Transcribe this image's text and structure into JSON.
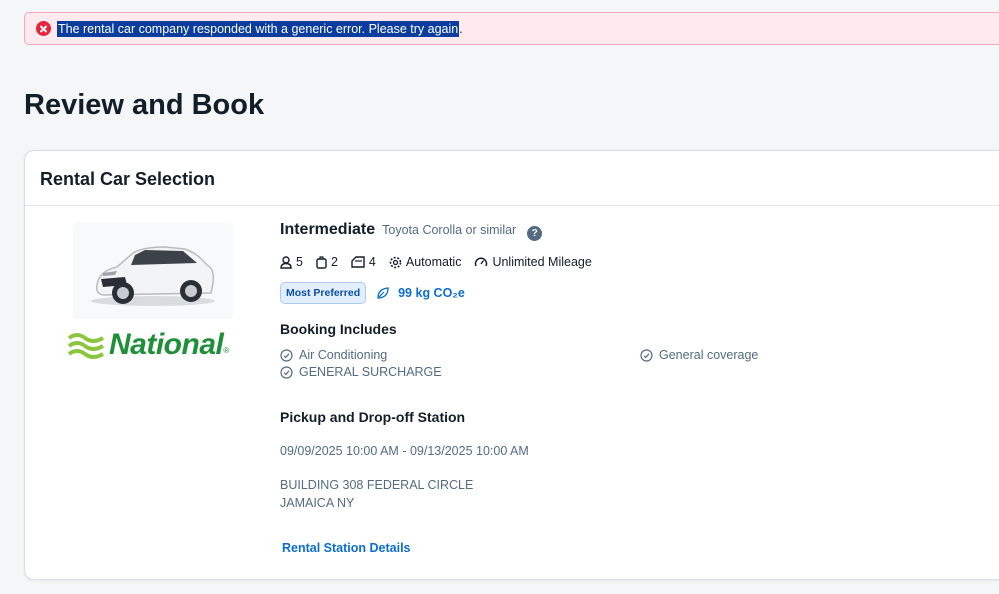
{
  "error": {
    "message": "The rental car company responded with a generic error. Please try again",
    "trailing": "."
  },
  "page": {
    "title": "Review and Book"
  },
  "card": {
    "title": "Rental Car Selection",
    "vendor": {
      "name": "National",
      "reg": "®"
    },
    "car": {
      "class": "Intermediate",
      "model": "Toyota Corolla or similar",
      "help": "?",
      "features": {
        "passengers": "5",
        "bags": "2",
        "doors": "4",
        "transmission": "Automatic",
        "mileage": "Unlimited Mileage"
      },
      "badge": "Most Preferred",
      "co2": "99 kg CO₂e"
    },
    "includes": {
      "heading": "Booking Includes",
      "items": [
        "Air Conditioning",
        "General coverage",
        "GENERAL SURCHARGE"
      ]
    },
    "pickup": {
      "heading": "Pickup and Drop-off Station",
      "dates": "09/09/2025 10:00 AM - 09/13/2025 10:00 AM",
      "address_line1": "BUILDING 308 FEDERAL CIRCLE",
      "address_line2": "JAMAICA NY",
      "details_link": "Rental Station Details"
    }
  },
  "colors": {
    "error": "#e5253d",
    "link": "#0a6ed1",
    "brand_green": "#1f8f3a"
  }
}
